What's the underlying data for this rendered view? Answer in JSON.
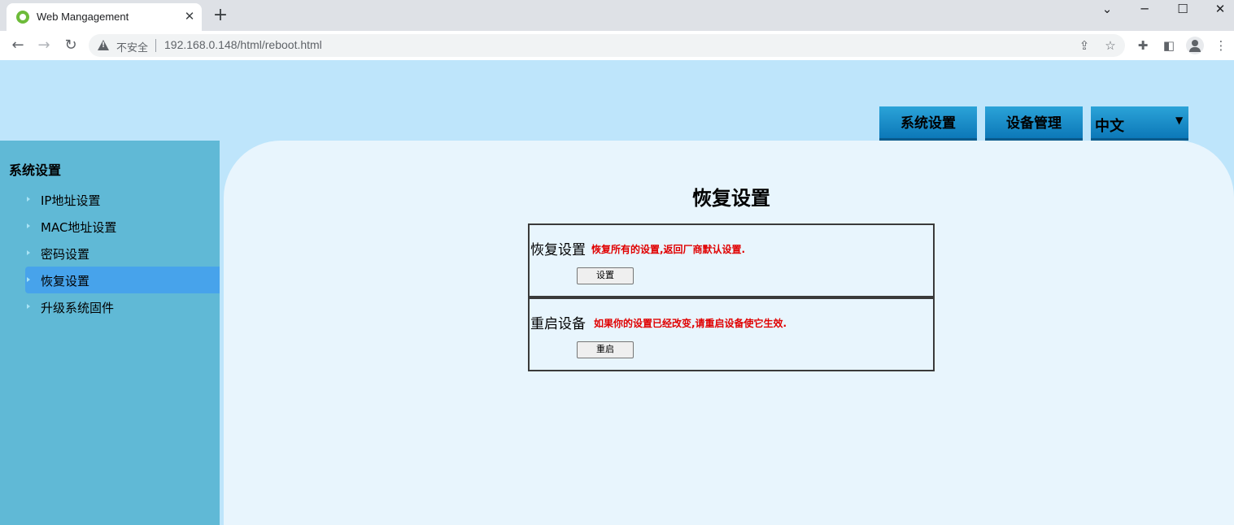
{
  "browser": {
    "tab_title": "Web Mangagement",
    "tab_close": "✕",
    "new_tab": "+",
    "not_secure": "不安全",
    "url": "192.168.0.148/html/reboot.html",
    "window_controls": {
      "dropdown": "⌄",
      "minimize": "─",
      "maximize": "☐",
      "close": "✕"
    },
    "nav": {
      "back": "←",
      "forward": "→",
      "reload": "↻"
    },
    "toolbar_icons": [
      "share-icon",
      "star-icon",
      "extensions-icon",
      "side-panel-icon",
      "profile-icon",
      "menu-icon"
    ]
  },
  "header": {
    "nav_buttons": [
      {
        "label": "系统设置"
      },
      {
        "label": "设备管理"
      }
    ],
    "language": {
      "value": "中文",
      "chevron": "⌄"
    }
  },
  "sidebar": {
    "title": "系统设置",
    "items": [
      {
        "label": "IP地址设置",
        "active": false
      },
      {
        "label": "MAC地址设置",
        "active": false
      },
      {
        "label": "密码设置",
        "active": false
      },
      {
        "label": "恢复设置",
        "active": true
      },
      {
        "label": "升级系统固件",
        "active": false
      }
    ]
  },
  "main": {
    "title": "恢复设置",
    "panels": [
      {
        "label": "恢复设置",
        "description": "恢复所有的设置,返回厂商默认设置.",
        "button": "设置"
      },
      {
        "label": "重启设备",
        "description": "如果你的设置已经改变,请重启设备使它生效.",
        "button": "重启"
      }
    ]
  },
  "colors": {
    "page_bg": "#bee5fb",
    "sidebar_bg": "#60b9d6",
    "sidebar_active": "#47a3eb",
    "content_bg": "#e8f5fd",
    "nav_button": "#1a8cc8",
    "warning_text": "#e00000"
  }
}
